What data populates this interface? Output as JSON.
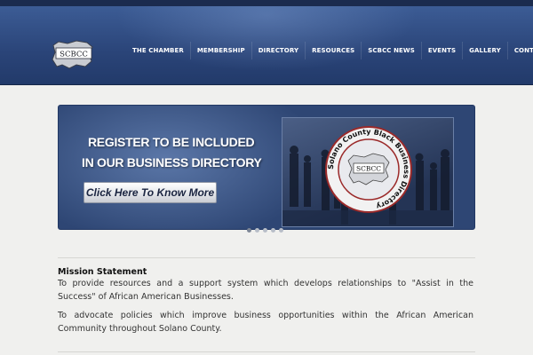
{
  "logo": {
    "text": "SCBCC"
  },
  "nav": {
    "items": [
      "THE CHAMBER",
      "MEMBERSHIP",
      "DIRECTORY",
      "RESOURCES",
      "SCBCC NEWS",
      "EVENTS",
      "GALLERY",
      "CONTACT"
    ]
  },
  "banner": {
    "line1": "REGISTER TO BE INCLUDED",
    "line2": "IN OUR BUSINESS DIRECTORY",
    "cta_label": "Click Here To Know More",
    "seal_ring_text": "Solano County Black Business Directory",
    "seal_center_text": "SCBCC"
  },
  "slider": {
    "slide_count": 5,
    "active_index": 0
  },
  "mission": {
    "title": "Mission Statement",
    "paragraphs": [
      "To provide resources and a support system which develops relationships to \"Assist in the Success\" of African American Businesses.",
      "To advocate policies which improve business opportunities within the African American Community throughout Solano County."
    ]
  },
  "colors": {
    "header": "#2d4a80",
    "topbar": "#1b2b4e",
    "page_bg": "#f0f0ee",
    "text": "#333333"
  }
}
